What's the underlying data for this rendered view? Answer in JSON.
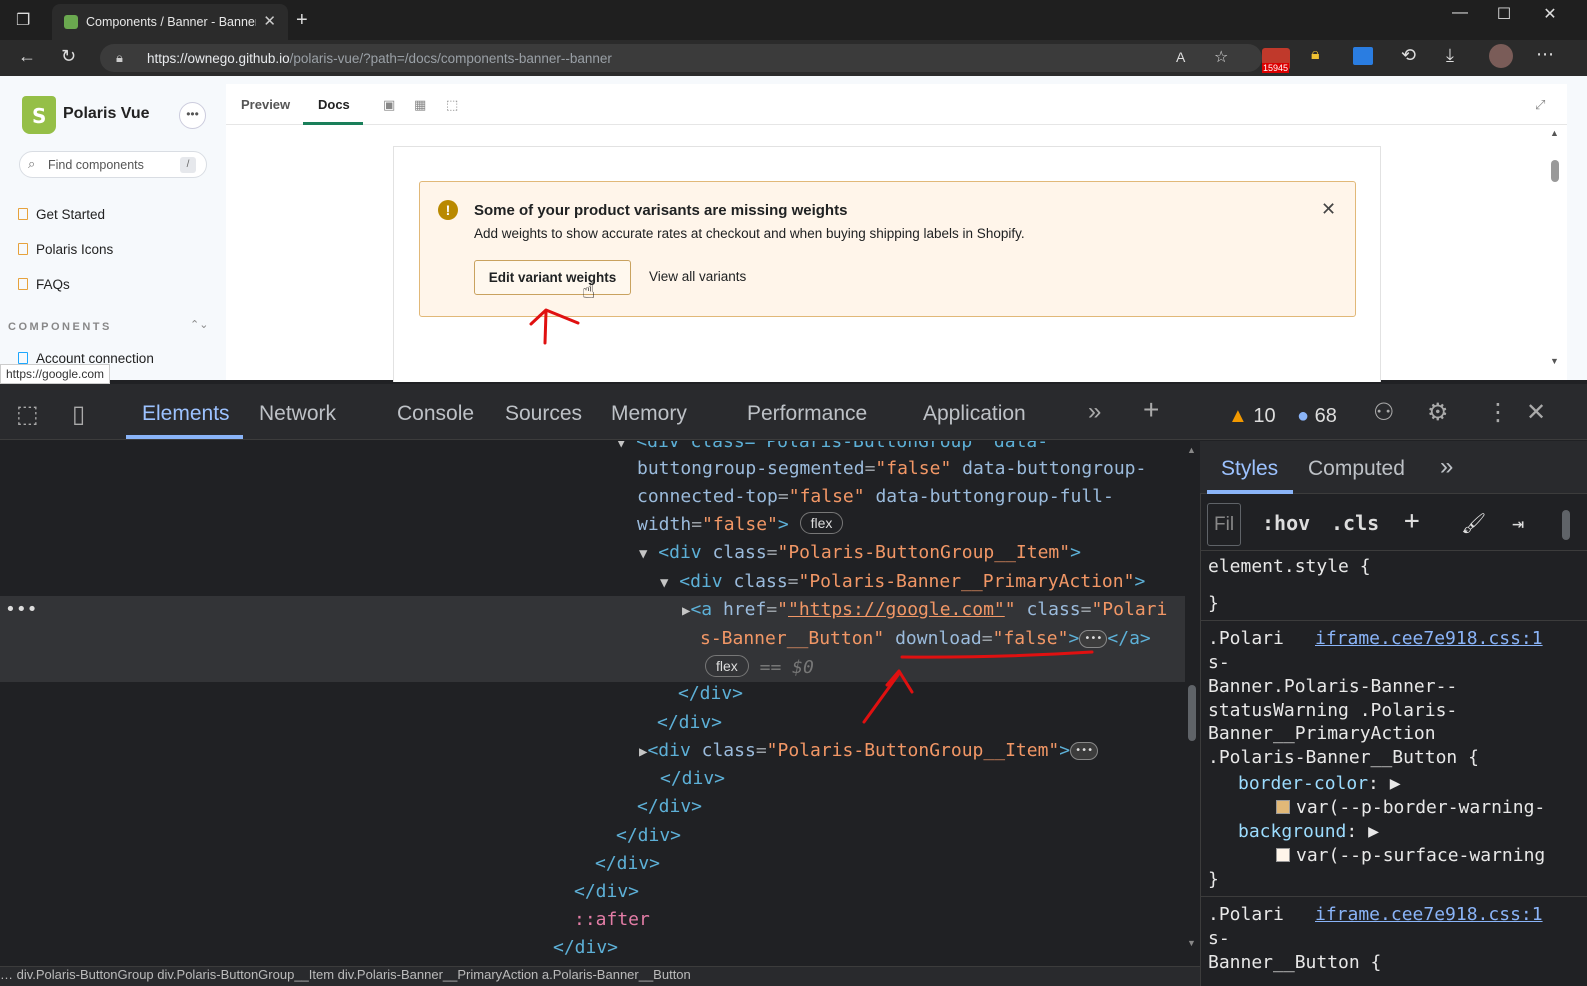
{
  "browser": {
    "tab_title": "Components / Banner - Banner ·",
    "url_host": "https://ownego.github.io",
    "url_path": "/polaris-vue/?path=/docs/components-banner--banner",
    "ext_badge": "15945",
    "status_link": "https://google.com"
  },
  "sidebar": {
    "brand": "Polaris Vue",
    "more_label": "•••",
    "search_placeholder": "Find components",
    "search_shortcut": "/",
    "items": [
      {
        "label": "Get Started"
      },
      {
        "label": "Polaris Icons"
      },
      {
        "label": "FAQs"
      }
    ],
    "section_header": "COMPONENTS",
    "section_first_item": "Account connection"
  },
  "storybook": {
    "tabs": [
      "Preview",
      "Docs"
    ],
    "active_tab": "Docs"
  },
  "banner": {
    "title": "Some of your product varisants are missing weights",
    "message": "Add weights to show accurate rates at checkout and when buying shipping labels in Shopify.",
    "primary_action": "Edit variant weights",
    "secondary_action": "View all variants",
    "status": "warning",
    "colors": {
      "background": "#fff5ea",
      "border": "#e1b878",
      "icon": "#b98900"
    }
  },
  "devtools": {
    "tabs": [
      "Elements",
      "Network",
      "Console",
      "Sources",
      "Memory",
      "Performance",
      "Application"
    ],
    "active_tab": "Elements",
    "warnings": "10",
    "messages": "68",
    "elements_lines": {
      "l0": "<div class=\"Polaris-ButtonGroup\" data-",
      "l1a": "buttongroup-segmented",
      "l1b": "\"false\"",
      "l1c": "data-buttongroup-",
      "l2a": "connected-top",
      "l2b": "\"false\"",
      "l2c": "data-buttongroup-full-",
      "l3a": "width",
      "l3b": "\"false\"",
      "flex": "flex",
      "item_class": "\"Polaris-ButtonGroup__Item\"",
      "primary_class": "\"Polaris-Banner__PrimaryAction\"",
      "href": "\"https://google.com\"",
      "a_class_1": "\"Polari",
      "a_class_2": "s-Banner__Button\"",
      "download_attr": "download",
      "download_val": "\"false\"",
      "dollar0": "== $0",
      "close_div": "</div>",
      "pseudo_after": "::after"
    },
    "breadcrumbs": "… div.Polaris-ButtonGroup  div.Polaris-ButtonGroup__Item  div.Polaris-Banner__PrimaryAction  a.Polaris-Banner__Button"
  },
  "styles_pane": {
    "tabs": [
      "Styles",
      "Computed"
    ],
    "active_tab": "Styles",
    "filter_placeholder": "Fil",
    "hov": ":hov",
    "cls": ".cls",
    "element_style": "element.style {",
    "close_brace": "}",
    "rule1": {
      "selector_lines": [
        ".Polari",
        "s-",
        "Banner.Polaris-Banner--",
        "statusWarning .Polaris-",
        "Banner__PrimaryAction",
        ".Polaris-Banner__Button {"
      ],
      "source": "iframe.cee7e918.css:1",
      "props": [
        {
          "name": "border-color",
          "value": "var(--p-border-warning-",
          "swatch": "#e1b878"
        },
        {
          "name": "background",
          "value": "var(--p-surface-warning",
          "swatch": "#fff5ea"
        }
      ]
    },
    "rule2": {
      "selector_lines": [
        ".Polari",
        "s-",
        "Banner__Button {"
      ],
      "source": "iframe.cee7e918.css:1"
    }
  }
}
